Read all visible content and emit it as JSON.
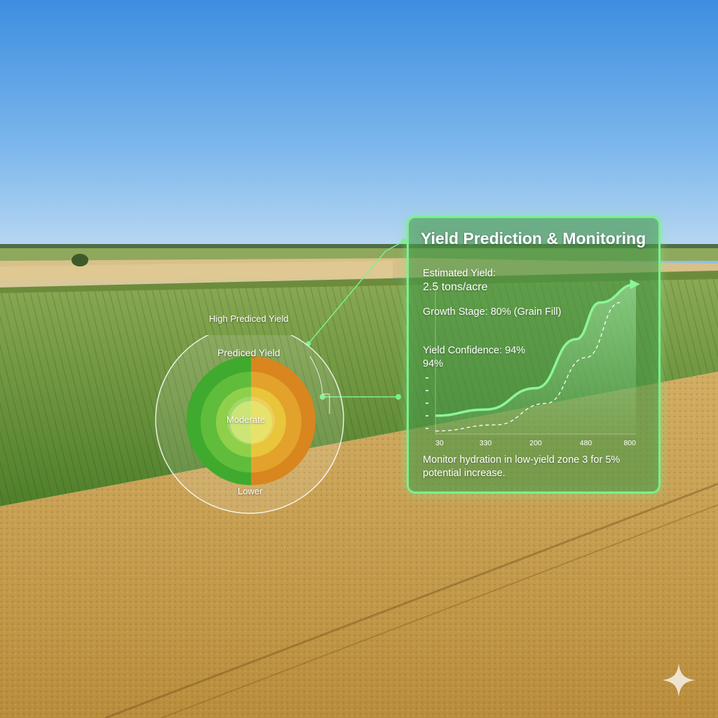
{
  "panel": {
    "title": "Yield Prediction & Monitoring",
    "estimated_yield_label": "Estimated Yield:",
    "estimated_yield_value": "2.5 tons/acre",
    "growth_stage": "Growth Stage: 80% (Grain Fill)",
    "yield_confidence_label": "Yield Confidence: 94%",
    "yield_confidence_value": "94%",
    "note": "Monitor hydration in low-yield zone 3 for 5% potential increase."
  },
  "gauge": {
    "label_high": "High Prediced Yield",
    "label_predicted": "Prediced Yield",
    "label_moderate": "Moderate",
    "label_lower": "Lower"
  },
  "chart_data": {
    "type": "line",
    "x_tick_labels": [
      "30",
      "330",
      "200",
      "480",
      "800"
    ],
    "series": [
      {
        "style": "solid-arrow",
        "color": "#8cf59a",
        "x": [
          0,
          0.25,
          0.5,
          0.7,
          0.82,
          1.0
        ],
        "y": [
          0.12,
          0.16,
          0.3,
          0.62,
          0.86,
          0.98
        ]
      },
      {
        "style": "dashed",
        "color": "#ffffff",
        "x": [
          0,
          0.3,
          0.55,
          0.75,
          0.92
        ],
        "y": [
          0.02,
          0.06,
          0.2,
          0.5,
          0.86
        ]
      }
    ]
  },
  "colors": {
    "accent": "#7cf08e",
    "sky_top": "#3f8fdf",
    "grain": "#c9a24e",
    "crop_green": "#6f9a3a"
  },
  "icons": {
    "corner": "sparkle-icon"
  }
}
